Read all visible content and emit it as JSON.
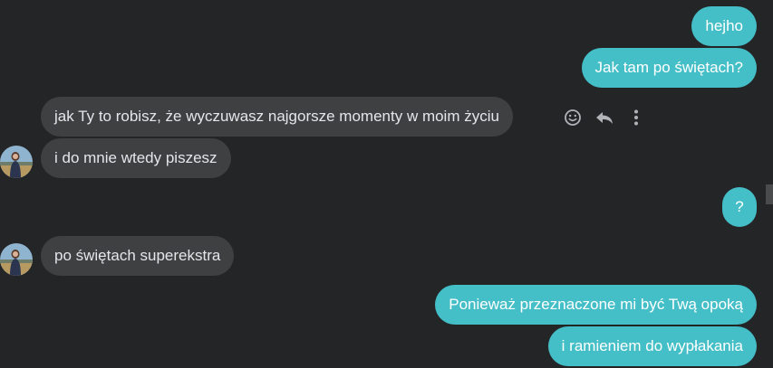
{
  "colors": {
    "background": "#242526",
    "outgoing_bubble": "#44bec7",
    "incoming_bubble": "#3e4042",
    "incoming_text": "#e4e6eb",
    "icon": "#b0b3b8"
  },
  "messages": [
    {
      "direction": "outgoing",
      "text": "hejho"
    },
    {
      "direction": "outgoing",
      "text": "Jak tam po świętach?"
    },
    {
      "direction": "incoming",
      "text": "jak Ty to robisz, że wyczuwasz najgorsze momenty w moim życiu"
    },
    {
      "direction": "incoming",
      "text": "i do mnie wtedy piszesz"
    },
    {
      "direction": "outgoing",
      "text": "?"
    },
    {
      "direction": "incoming",
      "text": "po świętach superekstra"
    },
    {
      "direction": "outgoing",
      "text": "Ponieważ przeznaczone mi być Twą opoką"
    },
    {
      "direction": "outgoing",
      "text": "i ramieniem do wypłakania"
    }
  ],
  "message_actions": [
    {
      "icon": "smiley-react-icon"
    },
    {
      "icon": "reply-arrow-icon"
    },
    {
      "icon": "more-vertical-icon"
    }
  ]
}
